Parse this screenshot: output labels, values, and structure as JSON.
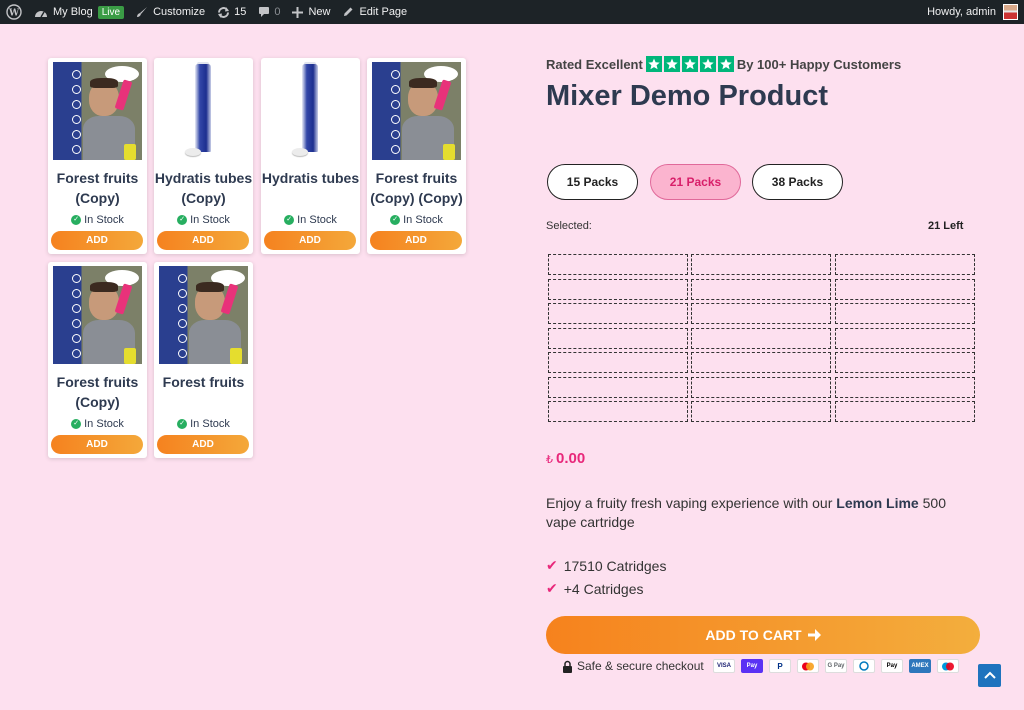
{
  "adminbar": {
    "site": "My Blog",
    "live": "Live",
    "customize": "Customize",
    "updates": "15",
    "comments": "0",
    "new": "New",
    "edit": "Edit Page",
    "howdy": "Howdy, admin"
  },
  "products": [
    {
      "title": "Forest fruits (Copy)",
      "image": "promo",
      "stock": "In Stock",
      "add": "ADD"
    },
    {
      "title": "Hydratis tubes (Copy)",
      "image": "tube",
      "stock": "In Stock",
      "add": "ADD"
    },
    {
      "title": "Hydratis tubes",
      "image": "tube",
      "stock": "In Stock",
      "add": "ADD"
    },
    {
      "title": "Forest fruits (Copy) (Copy)",
      "image": "promo",
      "stock": "In Stock",
      "add": "ADD"
    },
    {
      "title": "Forest fruits (Copy)",
      "image": "promo",
      "stock": "In Stock",
      "add": "ADD"
    },
    {
      "title": "Forest fruits",
      "image": "promo",
      "stock": "In Stock",
      "add": "ADD"
    }
  ],
  "rating": {
    "prefix": "Rated Excellent",
    "stars": 5,
    "suffix": "By 100+ Happy Customers"
  },
  "product": {
    "title": "Mixer Demo Product",
    "packs": [
      {
        "label": "15 Packs",
        "active": false
      },
      {
        "label": "21 Packs",
        "active": true
      },
      {
        "label": "38 Packs",
        "active": false
      }
    ],
    "selected_label": "Selected:",
    "left_label": "21 Left",
    "slots": 21,
    "price_currency": "₺",
    "price": "0.00",
    "desc_before": "Enjoy a fruity fresh vaping experience with our",
    "desc_bold": "Lemon Lime",
    "desc_after": "500 vape cartridge",
    "features": [
      "17510 Catridges",
      "+4 Catridges"
    ],
    "cart_label": "ADD TO CART",
    "secure_label": "Safe & secure checkout",
    "payments": [
      "VISA",
      "G Pay",
      "PayPal",
      "Mastercard",
      "G Pay",
      "Diners",
      "Apple Pay",
      "AMEX",
      "Maestro"
    ]
  },
  "colors": {
    "accent": "#e8277a",
    "orange": "#f5821f",
    "bg": "#fde0ef",
    "trust": "#00b67a"
  }
}
